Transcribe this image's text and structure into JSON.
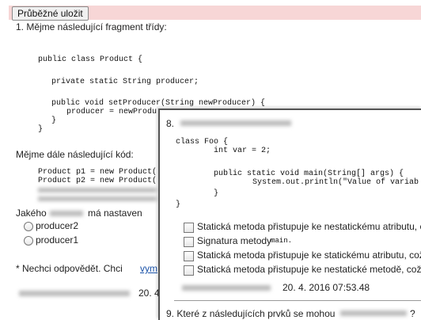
{
  "toolbar": {
    "save_label": "Průběžné uložit"
  },
  "q1": {
    "title": "1. Mějme následující fragment třídy:",
    "code": [
      "public class Product {",
      "private static String producer;",
      "public void setProducer(String newProducer) {",
      "producer = newProdu",
      "}",
      "}"
    ],
    "follow": "Mějme dále následující kód:",
    "code2": [
      "Product p1 = new Product(",
      "Product p2 = new Product("
    ],
    "question_start": "Jakého",
    "question_mid": "má nastaven",
    "options": [
      "producer2",
      "producer1"
    ],
    "no_answer": "* Nechci odpovědět. Chci",
    "no_answer_link": "vym",
    "date": "20. 4."
  },
  "q8": {
    "number": "8.",
    "code": [
      "class Foo {",
      "int var = 2;",
      "public static void main(String[] args) {",
      "System.out.println(\"Value of variab",
      "}",
      "}"
    ],
    "options": [
      "Statická metoda přistupuje ke nestatickému atributu, c",
      "Signatura metody",
      "Statická metoda přistupuje ke statickému atributu, což",
      "Statická metoda přistupuje ke nestatické metodě, což"
    ],
    "option2_code": "main.",
    "date": "20. 4. 2016 07:53.48"
  },
  "q9": {
    "title": "9. Které z následujících prvků se mohou",
    "title_end": "?"
  }
}
